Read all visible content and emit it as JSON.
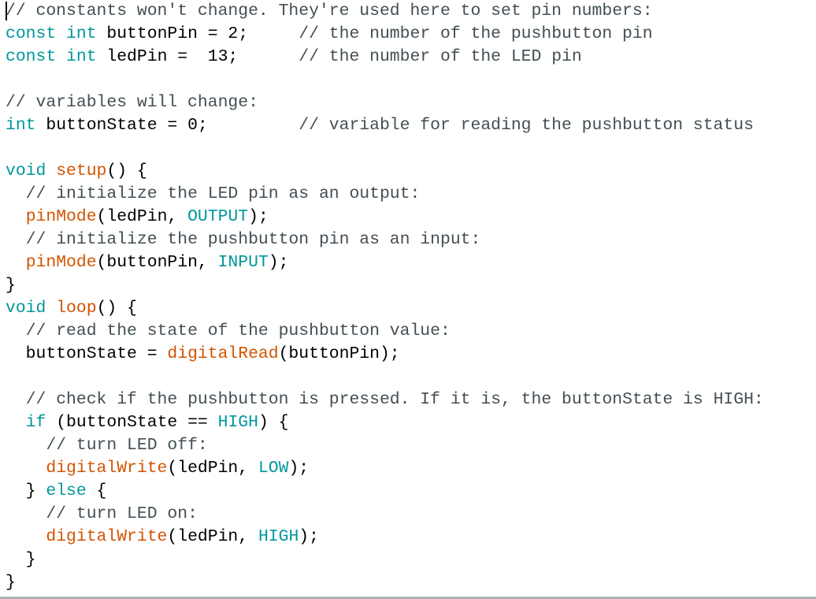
{
  "editor": {
    "colors": {
      "comment": "#434f54",
      "keyword": "#00979c",
      "function": "#d35400",
      "constant": "#00979c",
      "plain": "#000000"
    },
    "lines": [
      [
        {
          "t": "// constants won't change. They're used here to set pin numbers:",
          "c": "comment"
        }
      ],
      [
        {
          "t": "const",
          "c": "keyword"
        },
        {
          "t": " ",
          "c": "plain"
        },
        {
          "t": "int",
          "c": "keyword"
        },
        {
          "t": " buttonPin = 2;     ",
          "c": "plain"
        },
        {
          "t": "// the number of the pushbutton pin",
          "c": "comment"
        }
      ],
      [
        {
          "t": "const",
          "c": "keyword"
        },
        {
          "t": " ",
          "c": "plain"
        },
        {
          "t": "int",
          "c": "keyword"
        },
        {
          "t": " ledPin =  13;      ",
          "c": "plain"
        },
        {
          "t": "// the number of the LED pin",
          "c": "comment"
        }
      ],
      [],
      [
        {
          "t": "// variables will change:",
          "c": "comment"
        }
      ],
      [
        {
          "t": "int",
          "c": "keyword"
        },
        {
          "t": " buttonState = 0;         ",
          "c": "plain"
        },
        {
          "t": "// variable for reading the pushbutton status",
          "c": "comment"
        }
      ],
      [],
      [
        {
          "t": "void",
          "c": "keyword"
        },
        {
          "t": " ",
          "c": "plain"
        },
        {
          "t": "setup",
          "c": "function"
        },
        {
          "t": "() {",
          "c": "plain"
        }
      ],
      [
        {
          "t": "  ",
          "c": "plain"
        },
        {
          "t": "// initialize the LED pin as an output:",
          "c": "comment"
        }
      ],
      [
        {
          "t": "  ",
          "c": "plain"
        },
        {
          "t": "pinMode",
          "c": "function"
        },
        {
          "t": "(ledPin, ",
          "c": "plain"
        },
        {
          "t": "OUTPUT",
          "c": "constant"
        },
        {
          "t": ");",
          "c": "plain"
        }
      ],
      [
        {
          "t": "  ",
          "c": "plain"
        },
        {
          "t": "// initialize the pushbutton pin as an input:",
          "c": "comment"
        }
      ],
      [
        {
          "t": "  ",
          "c": "plain"
        },
        {
          "t": "pinMode",
          "c": "function"
        },
        {
          "t": "(buttonPin, ",
          "c": "plain"
        },
        {
          "t": "INPUT",
          "c": "constant"
        },
        {
          "t": ");",
          "c": "plain"
        }
      ],
      [
        {
          "t": "}",
          "c": "plain"
        }
      ],
      [
        {
          "t": "void",
          "c": "keyword"
        },
        {
          "t": " ",
          "c": "plain"
        },
        {
          "t": "loop",
          "c": "function"
        },
        {
          "t": "() {",
          "c": "plain"
        }
      ],
      [
        {
          "t": "  ",
          "c": "plain"
        },
        {
          "t": "// read the state of the pushbutton value:",
          "c": "comment"
        }
      ],
      [
        {
          "t": "  buttonState = ",
          "c": "plain"
        },
        {
          "t": "digitalRead",
          "c": "function"
        },
        {
          "t": "(buttonPin);",
          "c": "plain"
        }
      ],
      [],
      [
        {
          "t": "  ",
          "c": "plain"
        },
        {
          "t": "// check if the pushbutton is pressed. If it is, the buttonState is HIGH:",
          "c": "comment"
        }
      ],
      [
        {
          "t": "  ",
          "c": "plain"
        },
        {
          "t": "if",
          "c": "keyword"
        },
        {
          "t": " (buttonState == ",
          "c": "plain"
        },
        {
          "t": "HIGH",
          "c": "constant"
        },
        {
          "t": ") {",
          "c": "plain"
        }
      ],
      [
        {
          "t": "    ",
          "c": "plain"
        },
        {
          "t": "// turn LED off:",
          "c": "comment"
        }
      ],
      [
        {
          "t": "    ",
          "c": "plain"
        },
        {
          "t": "digitalWrite",
          "c": "function"
        },
        {
          "t": "(ledPin, ",
          "c": "plain"
        },
        {
          "t": "LOW",
          "c": "constant"
        },
        {
          "t": ");",
          "c": "plain"
        }
      ],
      [
        {
          "t": "  } ",
          "c": "plain"
        },
        {
          "t": "else",
          "c": "keyword"
        },
        {
          "t": " {",
          "c": "plain"
        }
      ],
      [
        {
          "t": "    ",
          "c": "plain"
        },
        {
          "t": "// turn LED on:",
          "c": "comment"
        }
      ],
      [
        {
          "t": "    ",
          "c": "plain"
        },
        {
          "t": "digitalWrite",
          "c": "function"
        },
        {
          "t": "(ledPin, ",
          "c": "plain"
        },
        {
          "t": "HIGH",
          "c": "constant"
        },
        {
          "t": ");",
          "c": "plain"
        }
      ],
      [
        {
          "t": "  }",
          "c": "plain"
        }
      ],
      [
        {
          "t": "}",
          "c": "plain"
        }
      ]
    ]
  }
}
